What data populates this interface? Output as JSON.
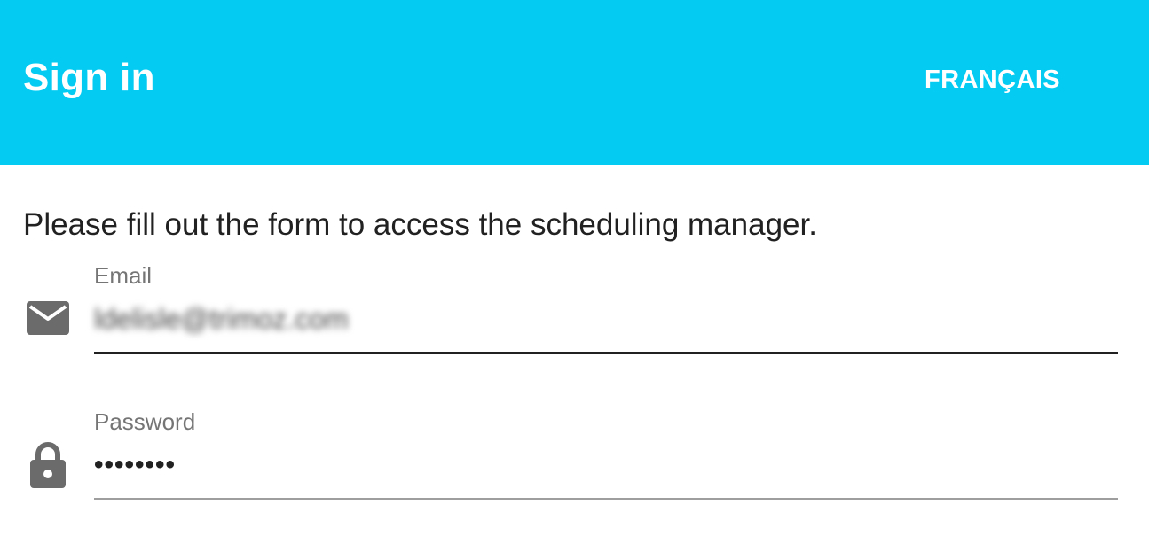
{
  "colors": {
    "appbar": "#03cbf2",
    "appbar_text": "#ffffff",
    "body_text": "#212121",
    "label_text": "#757575",
    "icon": "#6b6b6b"
  },
  "header": {
    "title": "Sign in",
    "language_button": "FRANÇAIS"
  },
  "main": {
    "intro_text": "Please fill out the form to access the scheduling manager."
  },
  "form": {
    "email": {
      "label": "Email",
      "value": "ldelisle@trimoz.com",
      "icon": "mail-icon"
    },
    "password": {
      "label": "Password",
      "value": "••••••••",
      "icon": "lock-icon"
    }
  }
}
